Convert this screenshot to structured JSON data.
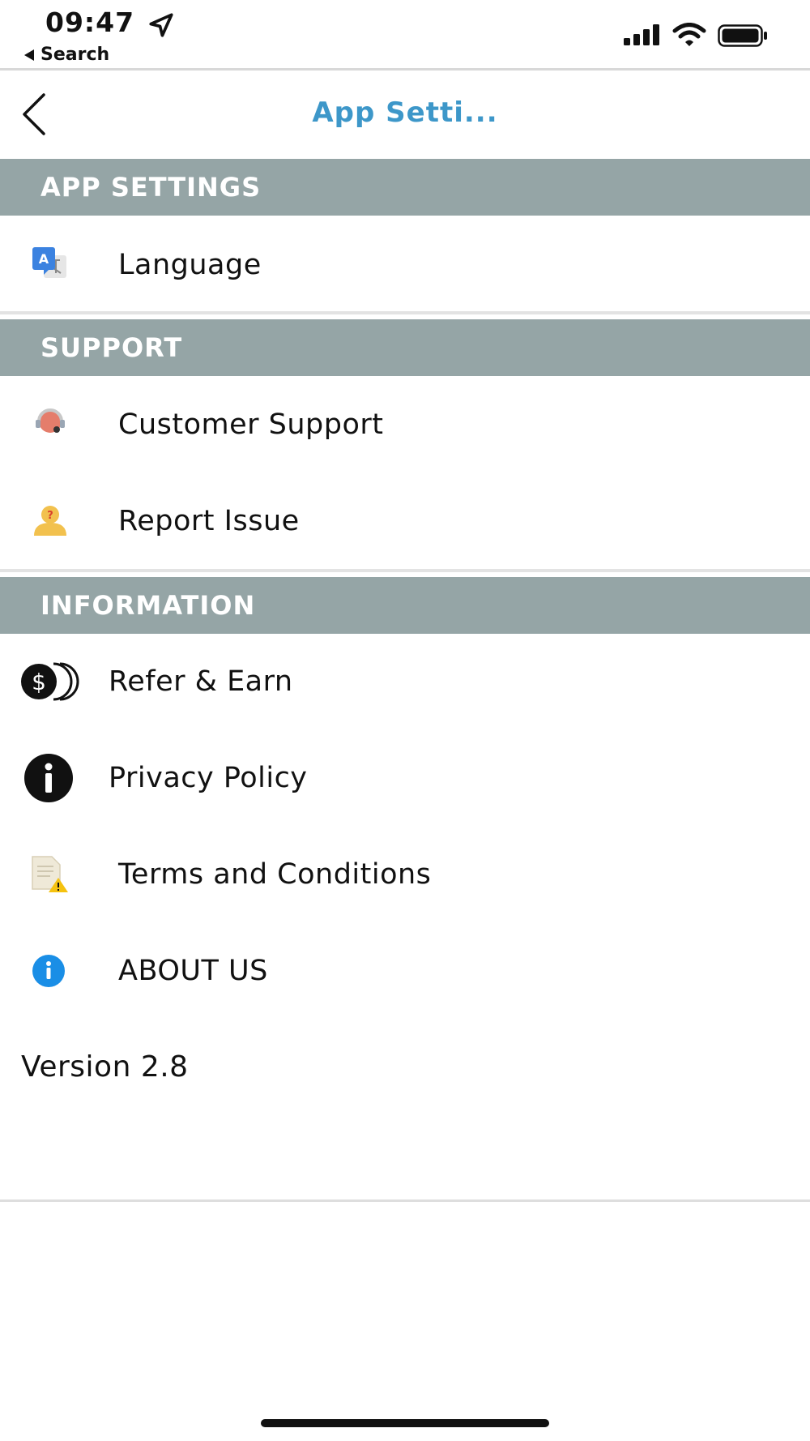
{
  "status_bar": {
    "time": "09:47",
    "back_label": "Search"
  },
  "nav": {
    "title": "App Setti..."
  },
  "sections": {
    "app_settings": {
      "title": "APP SETTINGS",
      "language": "Language"
    },
    "support": {
      "title": "SUPPORT",
      "customer_support": "Customer Support",
      "report_issue": "Report Issue"
    },
    "information": {
      "title": "INFORMATION",
      "refer_earn": "Refer & Earn",
      "privacy_policy": "Privacy Policy",
      "terms": "Terms and Conditions",
      "about": "ABOUT US"
    }
  },
  "version": "Version 2.8",
  "colors": {
    "section_header": "#95a5a6",
    "title": "#3d97c9"
  }
}
